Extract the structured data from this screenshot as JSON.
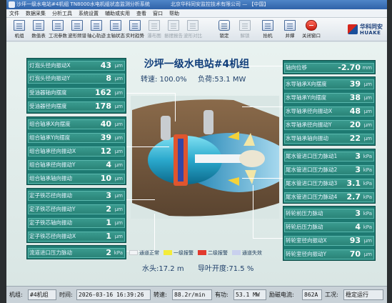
{
  "window": {
    "title": "沙坪一级水电站#4机组 TN8000水电机组状态监测分析系统",
    "center_title": "北京华科同安监控技术有限公司 — 【中国】"
  },
  "menu": [
    "文件",
    "数据采集",
    "分析工具",
    "系统设置",
    "辅助或实用",
    "查看",
    "窗口",
    "帮助"
  ],
  "toolbar": {
    "buttons": [
      "机组",
      "数值表",
      "工况参数",
      "波形频谱",
      "轴心轨迹",
      "主轴状态",
      "实时趋势",
      "瀑布图",
      "振摆报告",
      "波形对比",
      "锁定",
      "解锁",
      "抬机",
      "并撑",
      "关闭窗口"
    ]
  },
  "brand": {
    "cn": "华科同安",
    "en": "HUAKE"
  },
  "main": {
    "title": "沙坪一级水电站#4机组",
    "speed": "转速: 100.0%",
    "load": "负荷:53.1 MW",
    "head": "水头:17.2 m",
    "guide_vane": "导叶开度:71.5 %"
  },
  "left_panel": [
    {
      "name": "灯泡头径向振动X",
      "value": "43",
      "unit": "μm"
    },
    {
      "name": "灯泡头径向振动Y",
      "value": "8",
      "unit": "μm"
    },
    {
      "name": "受油器轴向摆度",
      "value": "162",
      "unit": "μm"
    },
    {
      "name": "受油器径向摆度",
      "value": "178",
      "unit": "μm"
    },
    {
      "name": "组合轴承X向摆度",
      "value": "40",
      "unit": "μm"
    },
    {
      "name": "组合轴承Y向摆度",
      "value": "39",
      "unit": "μm"
    },
    {
      "name": "组合轴承径向振动X",
      "value": "12",
      "unit": "μm"
    },
    {
      "name": "组合轴承径向振动Y",
      "value": "4",
      "unit": "μm"
    },
    {
      "name": "组合轴承轴向振动",
      "value": "10",
      "unit": "μm"
    },
    {
      "name": "定子铁芯径向振动",
      "value": "3",
      "unit": "μm"
    },
    {
      "name": "定子铁芯径向振动Y",
      "value": "2",
      "unit": "μm"
    },
    {
      "name": "定子铁芯轴向振动",
      "value": "1",
      "unit": "μm"
    },
    {
      "name": "定子铁芯径向振动X",
      "value": "1",
      "unit": "μm"
    },
    {
      "name": "流道进口压力脉动",
      "value": "2",
      "unit": "kPa"
    }
  ],
  "right_panel": [
    {
      "name": "轴向位移",
      "value": "-2.70",
      "unit": "mm"
    },
    {
      "name": "水导轴承X向摆度",
      "value": "39",
      "unit": "μm"
    },
    {
      "name": "水导轴承Y向摆度",
      "value": "38",
      "unit": "μm"
    },
    {
      "name": "水导轴承径向振动X",
      "value": "48",
      "unit": "μm"
    },
    {
      "name": "水导轴承径向振动Y",
      "value": "20",
      "unit": "μm"
    },
    {
      "name": "水导轴承轴向振动",
      "value": "22",
      "unit": "μm"
    },
    {
      "name": "尾水管进口压力脉动1",
      "value": "3",
      "unit": "kPa"
    },
    {
      "name": "尾水管进口压力脉动2",
      "value": "3",
      "unit": "kPa"
    },
    {
      "name": "尾水管进口压力脉动3",
      "value": "3.1",
      "unit": "kPa"
    },
    {
      "name": "尾水管进口压力脉动4",
      "value": "2.7",
      "unit": "kPa"
    },
    {
      "name": "转轮前压力脉动",
      "value": "3",
      "unit": "kPa"
    },
    {
      "name": "转轮后压力脉动",
      "value": "4",
      "unit": "kPa"
    },
    {
      "name": "转轮室径向振动X",
      "value": "93",
      "unit": "μm"
    },
    {
      "name": "转轮室径向振动Y",
      "value": "70",
      "unit": "μm"
    }
  ],
  "legend": [
    {
      "label": "通道正常",
      "color": "#f2f4f6"
    },
    {
      "label": "一级报警",
      "color": "#f4ec3a"
    },
    {
      "label": "二级报警",
      "color": "#e23a2e"
    },
    {
      "label": "通道失效",
      "color": "#c9d0ee"
    }
  ],
  "status": {
    "unit_label": "机组:",
    "unit": "#4机组",
    "time_label": "时间:",
    "time": "2026-03-16 16:39:26",
    "speed_label": "转速:",
    "speed": "88.2r/min",
    "power_label": "有功:",
    "power": "53.1 MW",
    "excite_label": "励磁电流:",
    "excite": "862A",
    "mode_label": "工况:",
    "mode": "稳定运行"
  }
}
